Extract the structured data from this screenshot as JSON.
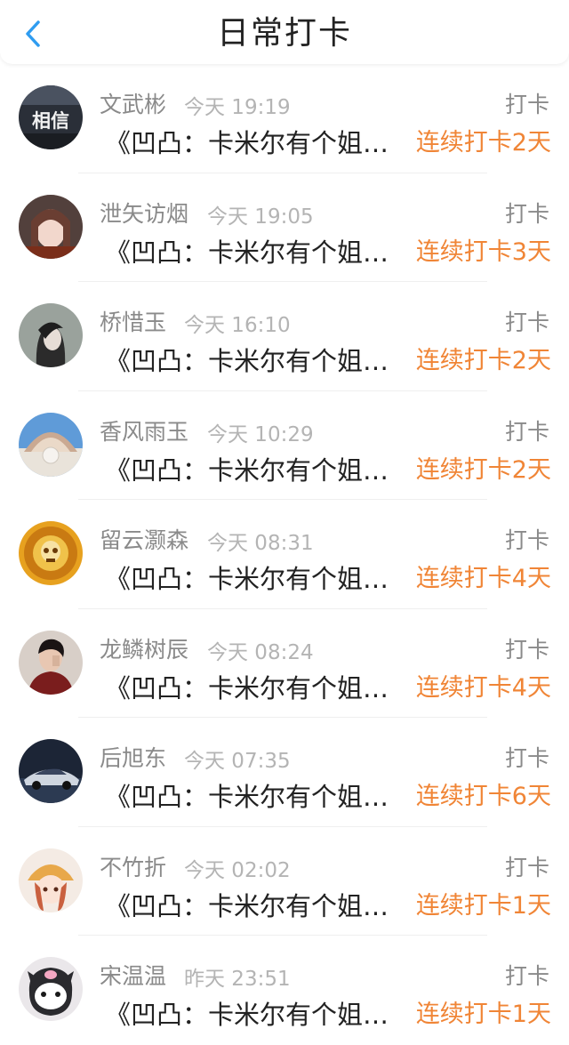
{
  "header": {
    "title": "日常打卡",
    "back_icon": "chevron-left-icon"
  },
  "colors": {
    "accent": "#f08536",
    "back": "#2f9cf0"
  },
  "list": [
    {
      "name": "文武彬",
      "time": "今天 19:19",
      "action": "打卡",
      "book": "《凹凸：卡米尔有个姐…",
      "streak": "连续打卡2天",
      "avatar_text": "相信"
    },
    {
      "name": "泄矢访烟",
      "time": "今天 19:05",
      "action": "打卡",
      "book": "《凹凸：卡米尔有个姐…",
      "streak": "连续打卡3天",
      "avatar_text": ""
    },
    {
      "name": "桥惜玉",
      "time": "今天 16:10",
      "action": "打卡",
      "book": "《凹凸：卡米尔有个姐…",
      "streak": "连续打卡2天",
      "avatar_text": ""
    },
    {
      "name": "香风雨玉",
      "time": "今天 10:29",
      "action": "打卡",
      "book": "《凹凸：卡米尔有个姐…",
      "streak": "连续打卡2天",
      "avatar_text": ""
    },
    {
      "name": "留云灏森",
      "time": "今天 08:31",
      "action": "打卡",
      "book": "《凹凸：卡米尔有个姐…",
      "streak": "连续打卡4天",
      "avatar_text": ""
    },
    {
      "name": "龙鳞树辰",
      "time": "今天 08:24",
      "action": "打卡",
      "book": "《凹凸：卡米尔有个姐…",
      "streak": "连续打卡4天",
      "avatar_text": ""
    },
    {
      "name": "后旭东",
      "time": "今天 07:35",
      "action": "打卡",
      "book": "《凹凸：卡米尔有个姐…",
      "streak": "连续打卡6天",
      "avatar_text": ""
    },
    {
      "name": "不竹折",
      "time": "今天 02:02",
      "action": "打卡",
      "book": "《凹凸：卡米尔有个姐…",
      "streak": "连续打卡1天",
      "avatar_text": ""
    },
    {
      "name": "宋温温",
      "time": "昨天 23:51",
      "action": "打卡",
      "book": "《凹凸：卡米尔有个姐…",
      "streak": "连续打卡1天",
      "avatar_text": ""
    }
  ]
}
